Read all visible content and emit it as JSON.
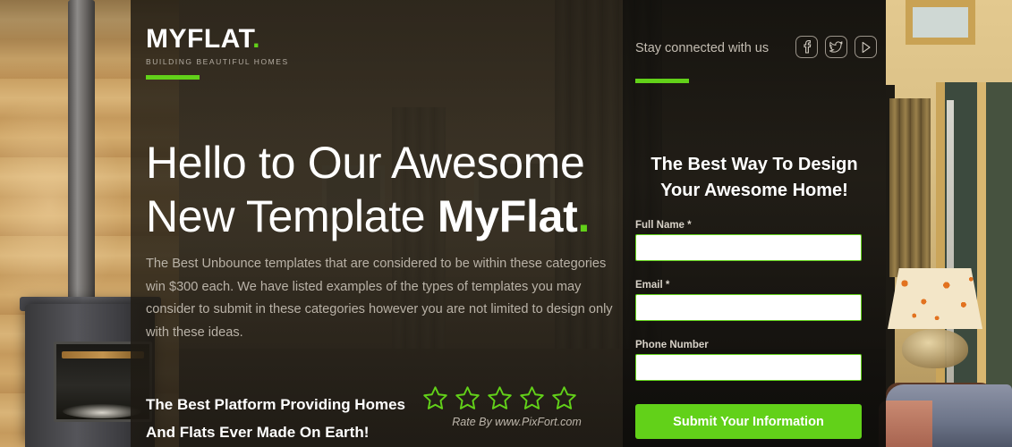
{
  "brand": {
    "name": "MYFLAT",
    "dot": ".",
    "tagline": "BUILDING BEAUTIFUL HOMES"
  },
  "social": {
    "text": "Stay connected with us",
    "icons": [
      {
        "name": "facebook-icon",
        "label": "Facebook"
      },
      {
        "name": "twitter-icon",
        "label": "Twitter"
      },
      {
        "name": "play-icon",
        "label": "Video"
      }
    ]
  },
  "hero": {
    "headline_line1": "Hello to Our Awesome",
    "headline_line2_prefix": "New Template ",
    "headline_brand": "MyFlat",
    "headline_dot": ".",
    "paragraph": "The Best Unbounce templates that are considered to be within these categories win $300 each. We have listed examples of the types of templates you may consider to submit in these categories however   you are not limited to design only with these ideas.",
    "tagline_line1": "The Best Platform Providing Homes",
    "tagline_line2": "And Flats Ever Made On Earth!"
  },
  "rating": {
    "stars_total": 5,
    "stars_filled": 0,
    "credit": "Rate By www.PixFort.com"
  },
  "form": {
    "title_line1": "The Best Way To Design",
    "title_line2": "Your Awesome Home!",
    "fields": [
      {
        "label": "Full Name",
        "required": "*",
        "value": "",
        "placeholder": ""
      },
      {
        "label": "Email",
        "required": "*",
        "value": "",
        "placeholder": ""
      },
      {
        "label": "Phone Number",
        "required": "",
        "value": "",
        "placeholder": ""
      }
    ],
    "submit_label": "Submit Your Information"
  },
  "colors": {
    "accent_green": "#62d119",
    "overlay_dark": "#201b13",
    "panel_dark": "#0e0d0a",
    "text_light": "#ffffff",
    "text_muted": "#b9b2a7"
  }
}
